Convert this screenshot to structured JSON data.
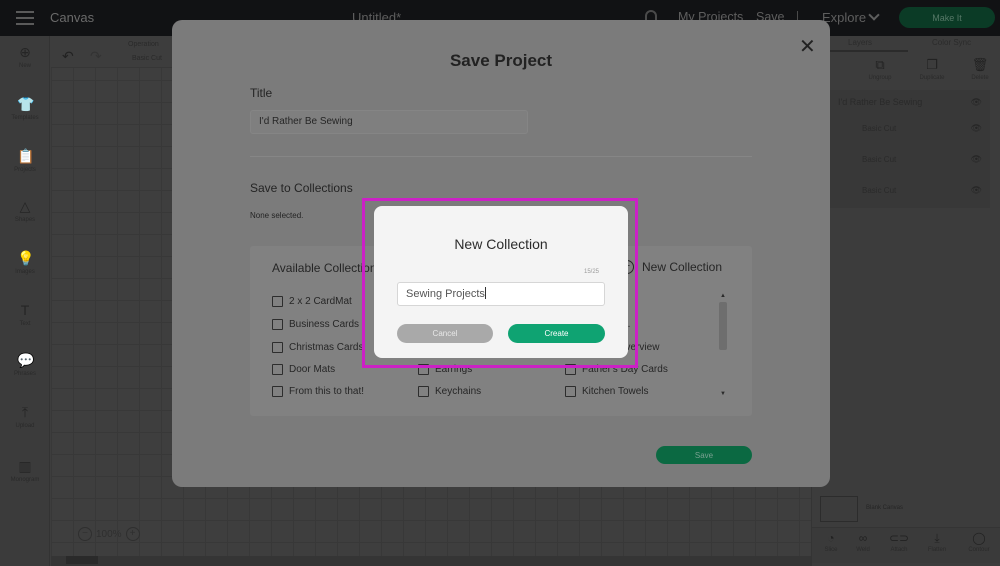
{
  "topbar": {
    "app_title": "Canvas",
    "doc_title": "Untitled*",
    "my_projects": "My Projects",
    "save": "Save",
    "explore": "Explore",
    "make_it": "Make It"
  },
  "sidebar": {
    "items": [
      {
        "label": "New",
        "icon": "plus-circle-icon",
        "glyph": "⊕"
      },
      {
        "label": "Templates",
        "icon": "shirt-icon",
        "glyph": "👕"
      },
      {
        "label": "Projects",
        "icon": "clipboard-icon",
        "glyph": "📋"
      },
      {
        "label": "Shapes",
        "icon": "shapes-icon",
        "glyph": "△"
      },
      {
        "label": "Images",
        "icon": "bulb-icon",
        "glyph": "💡"
      },
      {
        "label": "Text",
        "icon": "text-icon",
        "glyph": "T"
      },
      {
        "label": "Phrases",
        "icon": "speech-bubble-icon",
        "glyph": "💬"
      },
      {
        "label": "Upload",
        "icon": "upload-icon",
        "glyph": "⤒"
      },
      {
        "label": "Monogram",
        "icon": "monogram-icon",
        "glyph": "▥"
      }
    ]
  },
  "canvas_toolbar": {
    "operation_label": "Operation",
    "operation_value": "Basic Cut",
    "zoom_level": "100%"
  },
  "right_panel": {
    "tabs": [
      "Layers",
      "Color Sync"
    ],
    "actions": [
      {
        "label": "Ungroup",
        "glyph": "⧉"
      },
      {
        "label": "Duplicate",
        "glyph": "❐"
      },
      {
        "label": "Delete",
        "glyph": "🗑"
      }
    ],
    "group_name": "I'd Rather Be Sewing",
    "layers": [
      "Basic Cut",
      "Basic Cut",
      "Basic Cut"
    ],
    "blank_canvas": "Blank Canvas",
    "bottom_tools": [
      {
        "label": "Slice",
        "glyph": "◔"
      },
      {
        "label": "Weld",
        "glyph": "∞"
      },
      {
        "label": "Attach",
        "glyph": "⊂⊃"
      },
      {
        "label": "Flatten",
        "glyph": "⤓"
      },
      {
        "label": "Contour",
        "glyph": "◯"
      }
    ]
  },
  "save_modal": {
    "title": "Save Project",
    "title_label": "Title",
    "title_value": "I'd Rather Be Sewing",
    "collections_label": "Save to Collections",
    "none_selected": "None selected.",
    "available_label": "Available Collections",
    "new_collection_link": "New Collection",
    "collections": [
      [
        "2 x 2 CardMat",
        "Business Cards",
        "Christmas Cards",
        "Door Mats",
        "From this to that!"
      ],
      [
        "",
        "",
        "",
        "Earrings",
        "Keychains"
      ],
      [
        "",
        "Colors DS.",
        "Tutorial Overview",
        "Father's Day Cards",
        "Kitchen Towels"
      ]
    ],
    "save_button": "Save"
  },
  "new_collection_dialog": {
    "title": "New Collection",
    "char_count": "15/25",
    "input_value": "Sewing Projects",
    "cancel": "Cancel",
    "create": "Create",
    "highlight_color": "#cc20c6"
  }
}
